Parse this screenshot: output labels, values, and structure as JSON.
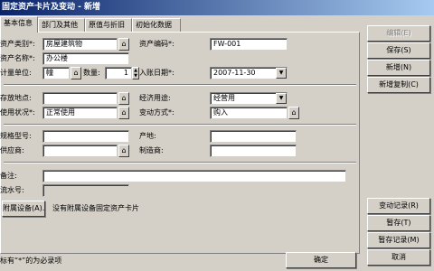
{
  "window": {
    "title": "固定资产卡片及变动 - 新增"
  },
  "tabs": [
    {
      "label": "基本信息"
    },
    {
      "label": "部门及其他"
    },
    {
      "label": "原值与折旧"
    },
    {
      "label": "初始化数据"
    }
  ],
  "form": {
    "category_label": "资产类别*:",
    "category_value": "房屋建筑物",
    "code_label": "资产编码*:",
    "code_value": "FW-001",
    "name_label": "资产名称*:",
    "name_value": "办公楼",
    "unit_label": "计量单位:",
    "unit_value": "幢",
    "qty_label": "数量:",
    "qty_value": "1",
    "date_label": "入账日期*:",
    "date_value": "2007-11-30",
    "location_label": "存放地点:",
    "location_value": "",
    "usage_label": "经济用途:",
    "usage_value": "经营用",
    "status_label": "使用状况*:",
    "status_value": "正常使用",
    "change_label": "变动方式*:",
    "change_value": "购入",
    "model_label": "规格型号:",
    "model_value": "",
    "origin_label": "产地:",
    "origin_value": "",
    "supplier_label": "供应商:",
    "supplier_value": "",
    "maker_label": "制造商:",
    "maker_value": "",
    "remark_label": "备注:",
    "remark_value": "",
    "voucher_label": "流水号:",
    "voucher_value": "",
    "attach_button": "附属设备(A)...",
    "attach_note": "没有附属设备固定资产卡片",
    "footnote": "标有“*”的为必录项",
    "ok_button": "确定",
    "btn_glyph": "⌂",
    "arrow_glyph": "▼",
    "spin_up": "▲",
    "spin_down": "▼"
  },
  "sidebar": {
    "edit_button": "编辑(E)",
    "save_button": "保存(S)",
    "new_button": "新增(N)",
    "copy_button": "新增复制(C)",
    "change_record_button": "变动记录(R)",
    "hold_button": "暂存(T)",
    "hold_record_button": "暂存记录(M)",
    "cancel_button": "取消"
  }
}
